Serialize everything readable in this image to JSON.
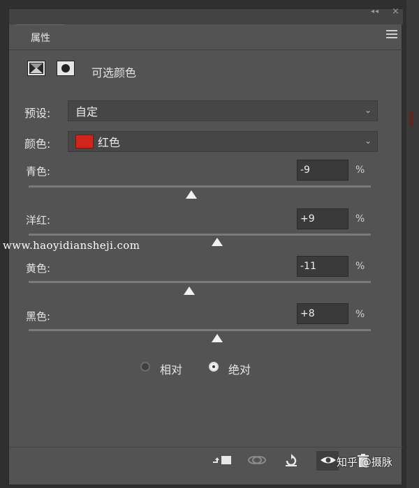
{
  "panel": {
    "tab_label": "属性",
    "adjustment_title": "可选颜色"
  },
  "preset": {
    "label": "预设:",
    "value": "自定"
  },
  "color": {
    "label": "颜色:",
    "value": "红色",
    "swatch_color": "#d1251b"
  },
  "sliders": [
    {
      "label": "青色:",
      "value": "-9",
      "unit": "%",
      "thumb_fraction": 0.475
    },
    {
      "label": "洋红:",
      "value": "+9",
      "unit": "%",
      "thumb_fraction": 0.55
    },
    {
      "label": "黄色:",
      "value": "-11",
      "unit": "%",
      "thumb_fraction": 0.47
    },
    {
      "label": "黑色:",
      "value": "+8",
      "unit": "%",
      "thumb_fraction": 0.55
    }
  ],
  "method": {
    "options": [
      {
        "label": "相对",
        "selected": false
      },
      {
        "label": "绝对",
        "selected": true
      }
    ]
  },
  "bottom_icons": [
    "clip-to-layer-icon",
    "view-previous-icon",
    "reset-icon",
    "visibility-eye-icon",
    "delete-icon"
  ],
  "watermark": "www.haoyidiansheji.com",
  "zhihu_watermark": "知乎 @摄脉"
}
